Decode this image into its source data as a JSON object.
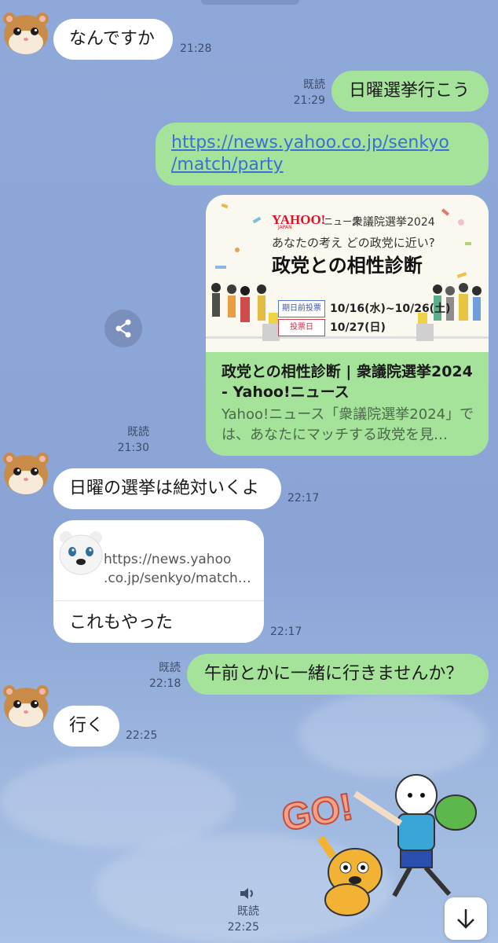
{
  "messages": [
    {
      "text": "なんですか",
      "time": "21:28"
    },
    {
      "text": "日曜選挙行こう",
      "read": "既読",
      "time": "21:29"
    },
    {
      "link_line1": "https://news.yahoo.co.jp/senkyo",
      "link_line2": "/match/party"
    },
    {
      "card_title": "政党との相性診断 | 衆議院選挙2024 - Yahoo!ニュース",
      "card_desc": "Yahoo!ニュース「衆議院選挙2024」では、あなたにマッチする政党を見…",
      "read": "既読",
      "time": "21:30"
    },
    {
      "text": "日曜の選挙は絶対いくよ",
      "time": "22:17"
    },
    {
      "quote_url_line1": "https://news.yahoo",
      "quote_url_line2": ".co.jp/senkyo/match…",
      "text": "これもやった",
      "time": "22:17"
    },
    {
      "text": "午前とかに一緒に行きませんか？",
      "read": "既読",
      "time": "22:18"
    },
    {
      "text": "行く",
      "time": "22:25"
    },
    {
      "read": "既読",
      "time": "22:25"
    }
  ],
  "banner": {
    "brand": "YAHOO!",
    "brand_sub": "JAPAN",
    "news": "ニュース",
    "election": "衆議院選挙2024",
    "question": "あなたの考え どの政党に近い?",
    "headline": "政党との相性診断",
    "early_label": "期日前投票",
    "early_dates": "10/16(水)~10/26(土)",
    "day_label": "投票日",
    "day_date": "10/27(日)"
  },
  "sticker_text": "GO!",
  "colors": {
    "bubble_right": "#a5e39a",
    "bubble_left": "#ffffff",
    "link": "#3a6fd6"
  },
  "icons": [
    "hamster-avatar",
    "polar-bear-avatar",
    "share-icon",
    "speaker-icon",
    "arrow-down-icon"
  ]
}
